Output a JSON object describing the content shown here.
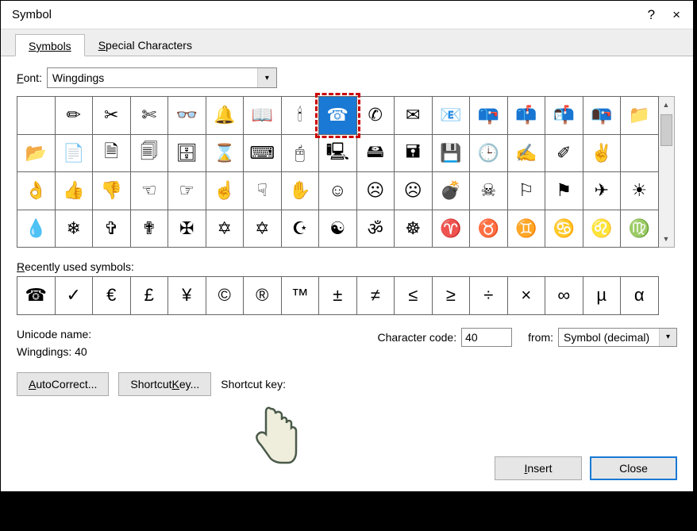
{
  "titlebar": {
    "title": "Symbol",
    "help": "?",
    "close": "×"
  },
  "tabs": {
    "symbols": "Symbols",
    "special": "Special Characters"
  },
  "font": {
    "label_pre": "F",
    "label_post": "ont:",
    "value": "Wingdings"
  },
  "grid": [
    [
      " ",
      "✏",
      "✂",
      "✄",
      "👓",
      "🔔",
      "📖",
      "🕯",
      "☎",
      "✆",
      "✉",
      "📧",
      "📪",
      "📫",
      "📬",
      "📭",
      "📁"
    ],
    [
      "📂",
      "📄",
      "🗎",
      "🗐",
      "🗄",
      "⌛",
      "⌨",
      "🖰",
      "🖳",
      "🖴",
      "🖬",
      "💾",
      "🕒",
      "✍",
      "✐",
      "✌"
    ],
    [
      "👌",
      "👍",
      "👎",
      "☜",
      "☞",
      "☝",
      "☟",
      "✋",
      "☺",
      "☹",
      "☹",
      "💣",
      "☠",
      "⚐",
      "⚑",
      "✈",
      "☀"
    ],
    [
      "💧",
      "❄",
      "✞",
      "✟",
      "✠",
      "✡",
      "✡",
      "☪",
      "☯",
      "ॐ",
      "☸",
      "♈",
      "♉",
      "♊",
      "♋",
      "♌",
      "♍"
    ]
  ],
  "selected": {
    "row": 0,
    "col": 8
  },
  "recent_label": "Recently used symbols:",
  "recent": [
    "☎",
    "✓",
    "€",
    "£",
    "¥",
    "©",
    "®",
    "™",
    "±",
    "≠",
    "≤",
    "≥",
    "÷",
    "×",
    "∞",
    "µ",
    "α"
  ],
  "unicode_name": "Unicode name:",
  "symbol_name": "Wingdings: 40",
  "charcode_label": "Character code:",
  "charcode_value": "40",
  "from_label": "from:",
  "from_value": "Symbol (decimal)",
  "autocorrect": "AutoCorrect...",
  "shortcut_btn": "Shortcut Key...",
  "shortcut_label": "Shortcut key:",
  "insert": "Insert",
  "close": "Close"
}
